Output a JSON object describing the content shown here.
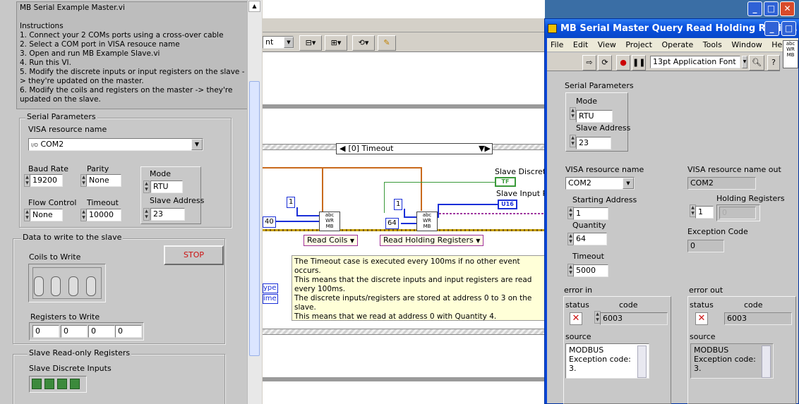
{
  "master_panel": {
    "instructions": "MB Serial Example Master.vi\n\nInstructions\n1. Connect your 2 COMs ports using a cross-over cable\n2. Select a COM port in VISA resouce name\n3. Open and run MB Example Slave.vi\n4. Run this VI.\n5. Modify the discrete inputs or input registers on the slave -> they're updated on the master.\n6. Modify the coils and registers on the master -> they're updated on the slave.",
    "serial_parameters": {
      "title": "Serial Parameters",
      "visa_label": "VISA resource name",
      "visa_prefix": "I/O",
      "visa_value": "COM2",
      "baud_label": "Baud Rate",
      "baud_value": "19200",
      "parity_label": "Parity",
      "parity_value": "None",
      "flow_label": "Flow Control",
      "flow_value": "None",
      "timeout_label": "Timeout",
      "timeout_value": "10000",
      "mode_label": "Mode",
      "mode_value": "RTU",
      "slave_addr_label": "Slave Address",
      "slave_addr_value": "23"
    },
    "data_to_write": {
      "title": "Data to write to the slave",
      "stop_label": "STOP",
      "coils_label": "Coils to Write",
      "registers_label": "Registers to Write",
      "registers": [
        "0",
        "0",
        "0",
        "0"
      ]
    },
    "slave_readonly": {
      "title": "Slave Read-only Registers",
      "discrete_label": "Slave Discrete Inputs"
    }
  },
  "diagram": {
    "toolbar_font": "nt",
    "event_case_label": "[0] Timeout",
    "const_1a": "1",
    "const_1b": "1",
    "const_40": "40",
    "const_64": "64",
    "mb_vi_text": "abc\nWR\nMB",
    "read_coils": "Read Coils",
    "read_holding": "Read Holding Registers",
    "slave_discrete": "Slave Discrete",
    "slave_input": "Slave Input R",
    "tf_term": "TF",
    "u16_term": "U16",
    "type_label": "ype",
    "time_label": "ime",
    "comment": "The Timeout case is executed every 100ms if no other event occurs.\nThis means that the discrete inputs and input registers are read every 100ms.\nThe discrete inputs/registers are stored at address 0 to 3 on the slave.\nThis means that we read at address 0 with Quantity 4.\nThe slave is continually reading commands and will respond to the master'\nreturning the data."
  },
  "query_window": {
    "title": "MB Serial Master Query Read Holding Regis...",
    "menu": [
      "File",
      "Edit",
      "View",
      "Project",
      "Operate",
      "Tools",
      "Window",
      "Help"
    ],
    "font_select": "13pt Application Font",
    "serial_params_title": "Serial Parameters",
    "mode_label": "Mode",
    "mode_value": "RTU",
    "slave_addr_label": "Slave Address",
    "slave_addr_value": "23",
    "visa_label": "VISA resource name",
    "visa_value": "COM2",
    "visa_out_label": "VISA resource name out",
    "visa_out_value": "COM2",
    "start_addr_label": "Starting Address",
    "start_addr_value": "1",
    "holding_label": "Holding Registers",
    "holding_index": "1",
    "holding_value": "0",
    "quantity_label": "Quantity",
    "quantity_value": "64",
    "exception_label": "Exception Code",
    "exception_value": "0",
    "timeout_label": "Timeout",
    "timeout_value": "5000",
    "error_in": {
      "title": "error in",
      "status_label": "status",
      "code_label": "code",
      "code_value": "6003",
      "source_label": "source",
      "source_value": "MODBUS Exception code: 3."
    },
    "error_out": {
      "title": "error out",
      "status_label": "status",
      "code_label": "code",
      "code_value": "6003",
      "source_label": "source",
      "source_value": "MODBUS Exception code: 3."
    }
  }
}
